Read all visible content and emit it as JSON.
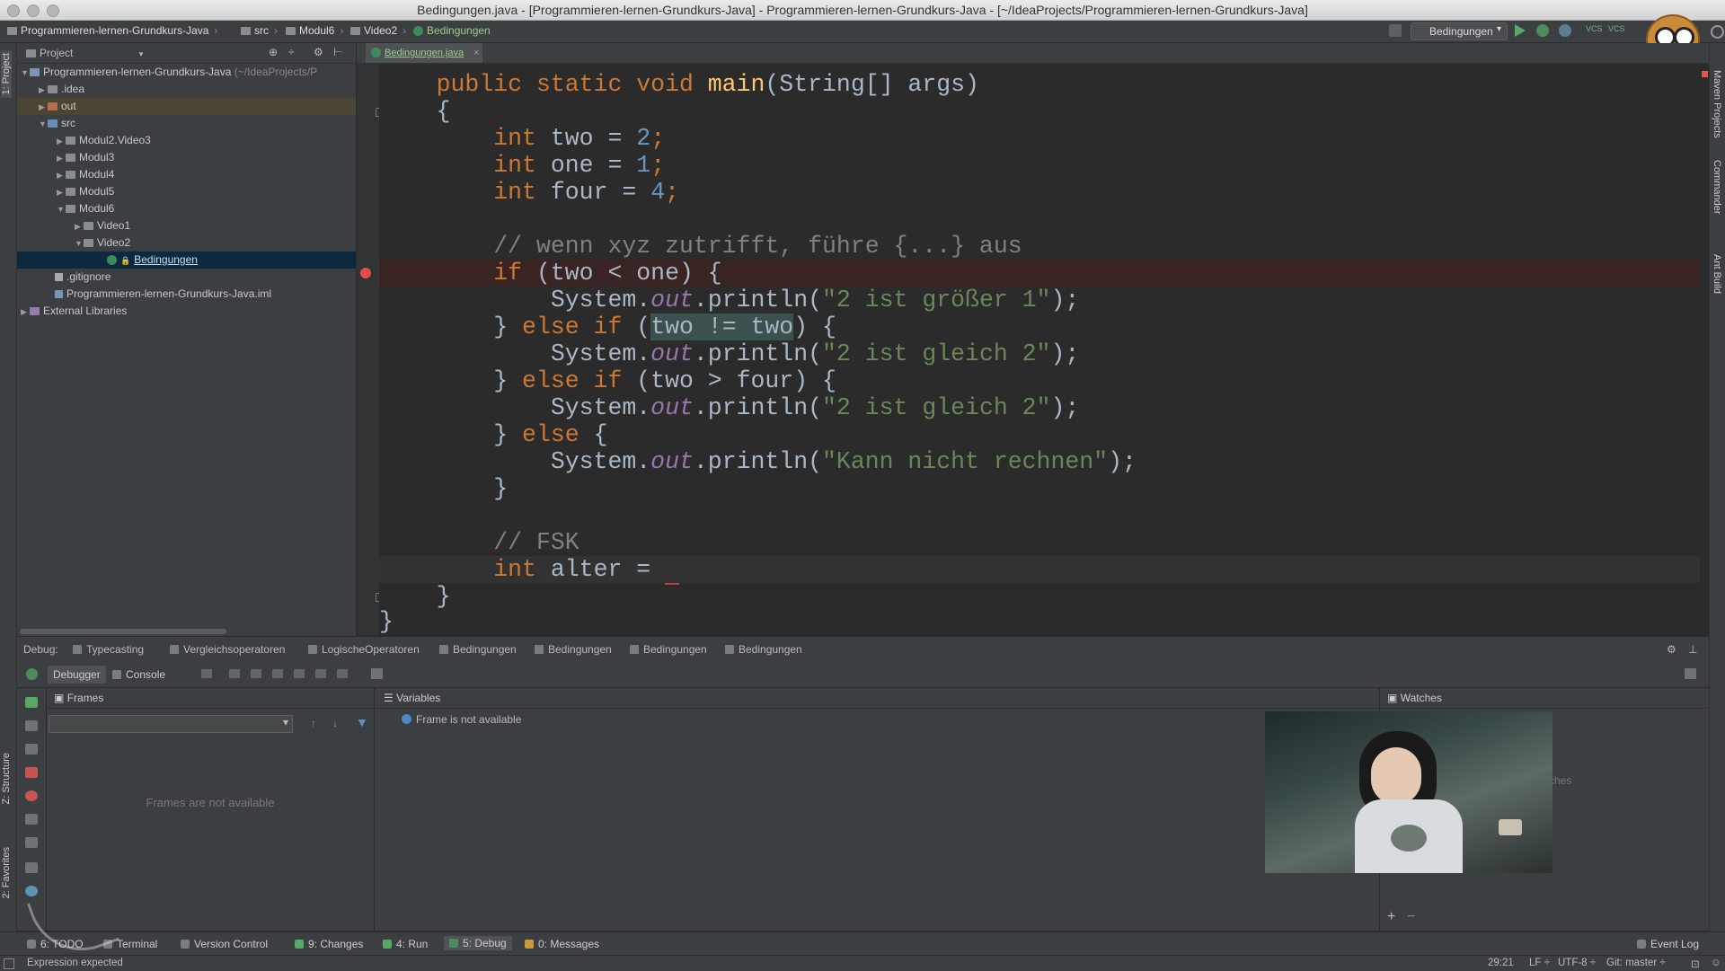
{
  "window": {
    "title": "Bedingungen.java - [Programmieren-lernen-Grundkurs-Java] - Programmieren-lernen-Grundkurs-Java - [~/IdeaProjects/Programmieren-lernen-Grundkurs-Java]"
  },
  "breadcrumbs": [
    "Programmieren-lernen-Grundkurs-Java",
    "src",
    "Modul6",
    "Video2",
    "Bedingungen"
  ],
  "run_config": "Bedingungen",
  "left_stripe": {
    "project_tab": "1: Project",
    "structure_tab": "Z: Structure",
    "favorites_tab": "2: Favorites"
  },
  "right_stripe": {
    "maven": "Maven Projects",
    "commander": "Commander",
    "ant": "Ant Build"
  },
  "project_panel": {
    "header": "Project",
    "root_name": "Programmieren-lernen-Grundkurs-Java",
    "root_path": "(~/IdeaProjects/P",
    "items": {
      "idea": ".idea",
      "out": "out",
      "src": "src",
      "m2v3": "Modul2.Video3",
      "m3": "Modul3",
      "m4": "Modul4",
      "m5": "Modul5",
      "m6": "Modul6",
      "v1": "Video1",
      "v2": "Video2",
      "bed": "Bedingungen",
      "gitignore": ".gitignore",
      "iml": "Programmieren-lernen-Grundkurs-Java.iml",
      "extlib": "External Libraries"
    }
  },
  "editor": {
    "tab": "Bedingungen.java",
    "lines": {
      "l1_a": "public static void ",
      "l1_b": "main",
      "l1_c": "(String[] args)",
      "l2": "{",
      "l3_kw": "int",
      "l3_b": " two = ",
      "l3_n": "2",
      "l4_kw": "int",
      "l4_b": " one = ",
      "l4_n": "1",
      "l5_kw": "int",
      "l5_b": " four = ",
      "l5_n": "4",
      "l6_c": "// wenn xyz zutrifft, führe {...} aus",
      "l7_kw": "if",
      "l7_b": " (two < one) {",
      "l8_a": "System.",
      "l8_out": "out",
      "l8_b": ".println(",
      "l8_s": "\"2 ist größer 1\"",
      "l8_e": ");",
      "l9_a": "} ",
      "l9_kw": "else if",
      "l9_b": " (",
      "l9_sel": "two != two",
      "l9_c": ") {",
      "l10_s": "\"2 ist gleich 2\"",
      "l11_a": "} ",
      "l11_kw": "else if",
      "l11_b": " (two > four) {",
      "l12_s": "\"2 ist gleich 2\"",
      "l13_a": "} ",
      "l13_kw": "else",
      "l13_b": " {",
      "l14_s": "\"Kann nicht rechnen\"",
      "l15": "}",
      "l16_c": "// FSK",
      "l17_kw": "int",
      "l17_b": " alter = ",
      "l18": "}",
      "l19": "}"
    }
  },
  "debug": {
    "label": "Debug:",
    "tabs": [
      "Typecasting",
      "Vergleichsoperatoren",
      "LogischeOperatoren",
      "Bedingungen",
      "Bedingungen",
      "Bedingungen",
      "Bedingungen"
    ],
    "debugger_tab": "Debugger",
    "console_tab": "Console",
    "frames_header": "Frames",
    "frames_empty": "Frames are not available",
    "variables_header": "Variables",
    "variables_msg": "Frame is not available",
    "watches_header": "Watches",
    "watches_partial": "ches"
  },
  "bottom_tools": {
    "todo": "6: TODO",
    "terminal": "Terminal",
    "vcs": "Version Control",
    "changes": "9: Changes",
    "run": "4: Run",
    "debug": "5: Debug",
    "messages": "0: Messages",
    "event_log": "Event Log"
  },
  "status": {
    "message": "Expression expected",
    "position": "29:21",
    "line_sep": "LF",
    "encoding": "UTF-8",
    "git": "Git: master"
  },
  "colors": {
    "keyword": "#cc7832",
    "number": "#6897bb",
    "string": "#6a8759",
    "comment": "#808080",
    "breakpoint": "#e54d4d"
  }
}
